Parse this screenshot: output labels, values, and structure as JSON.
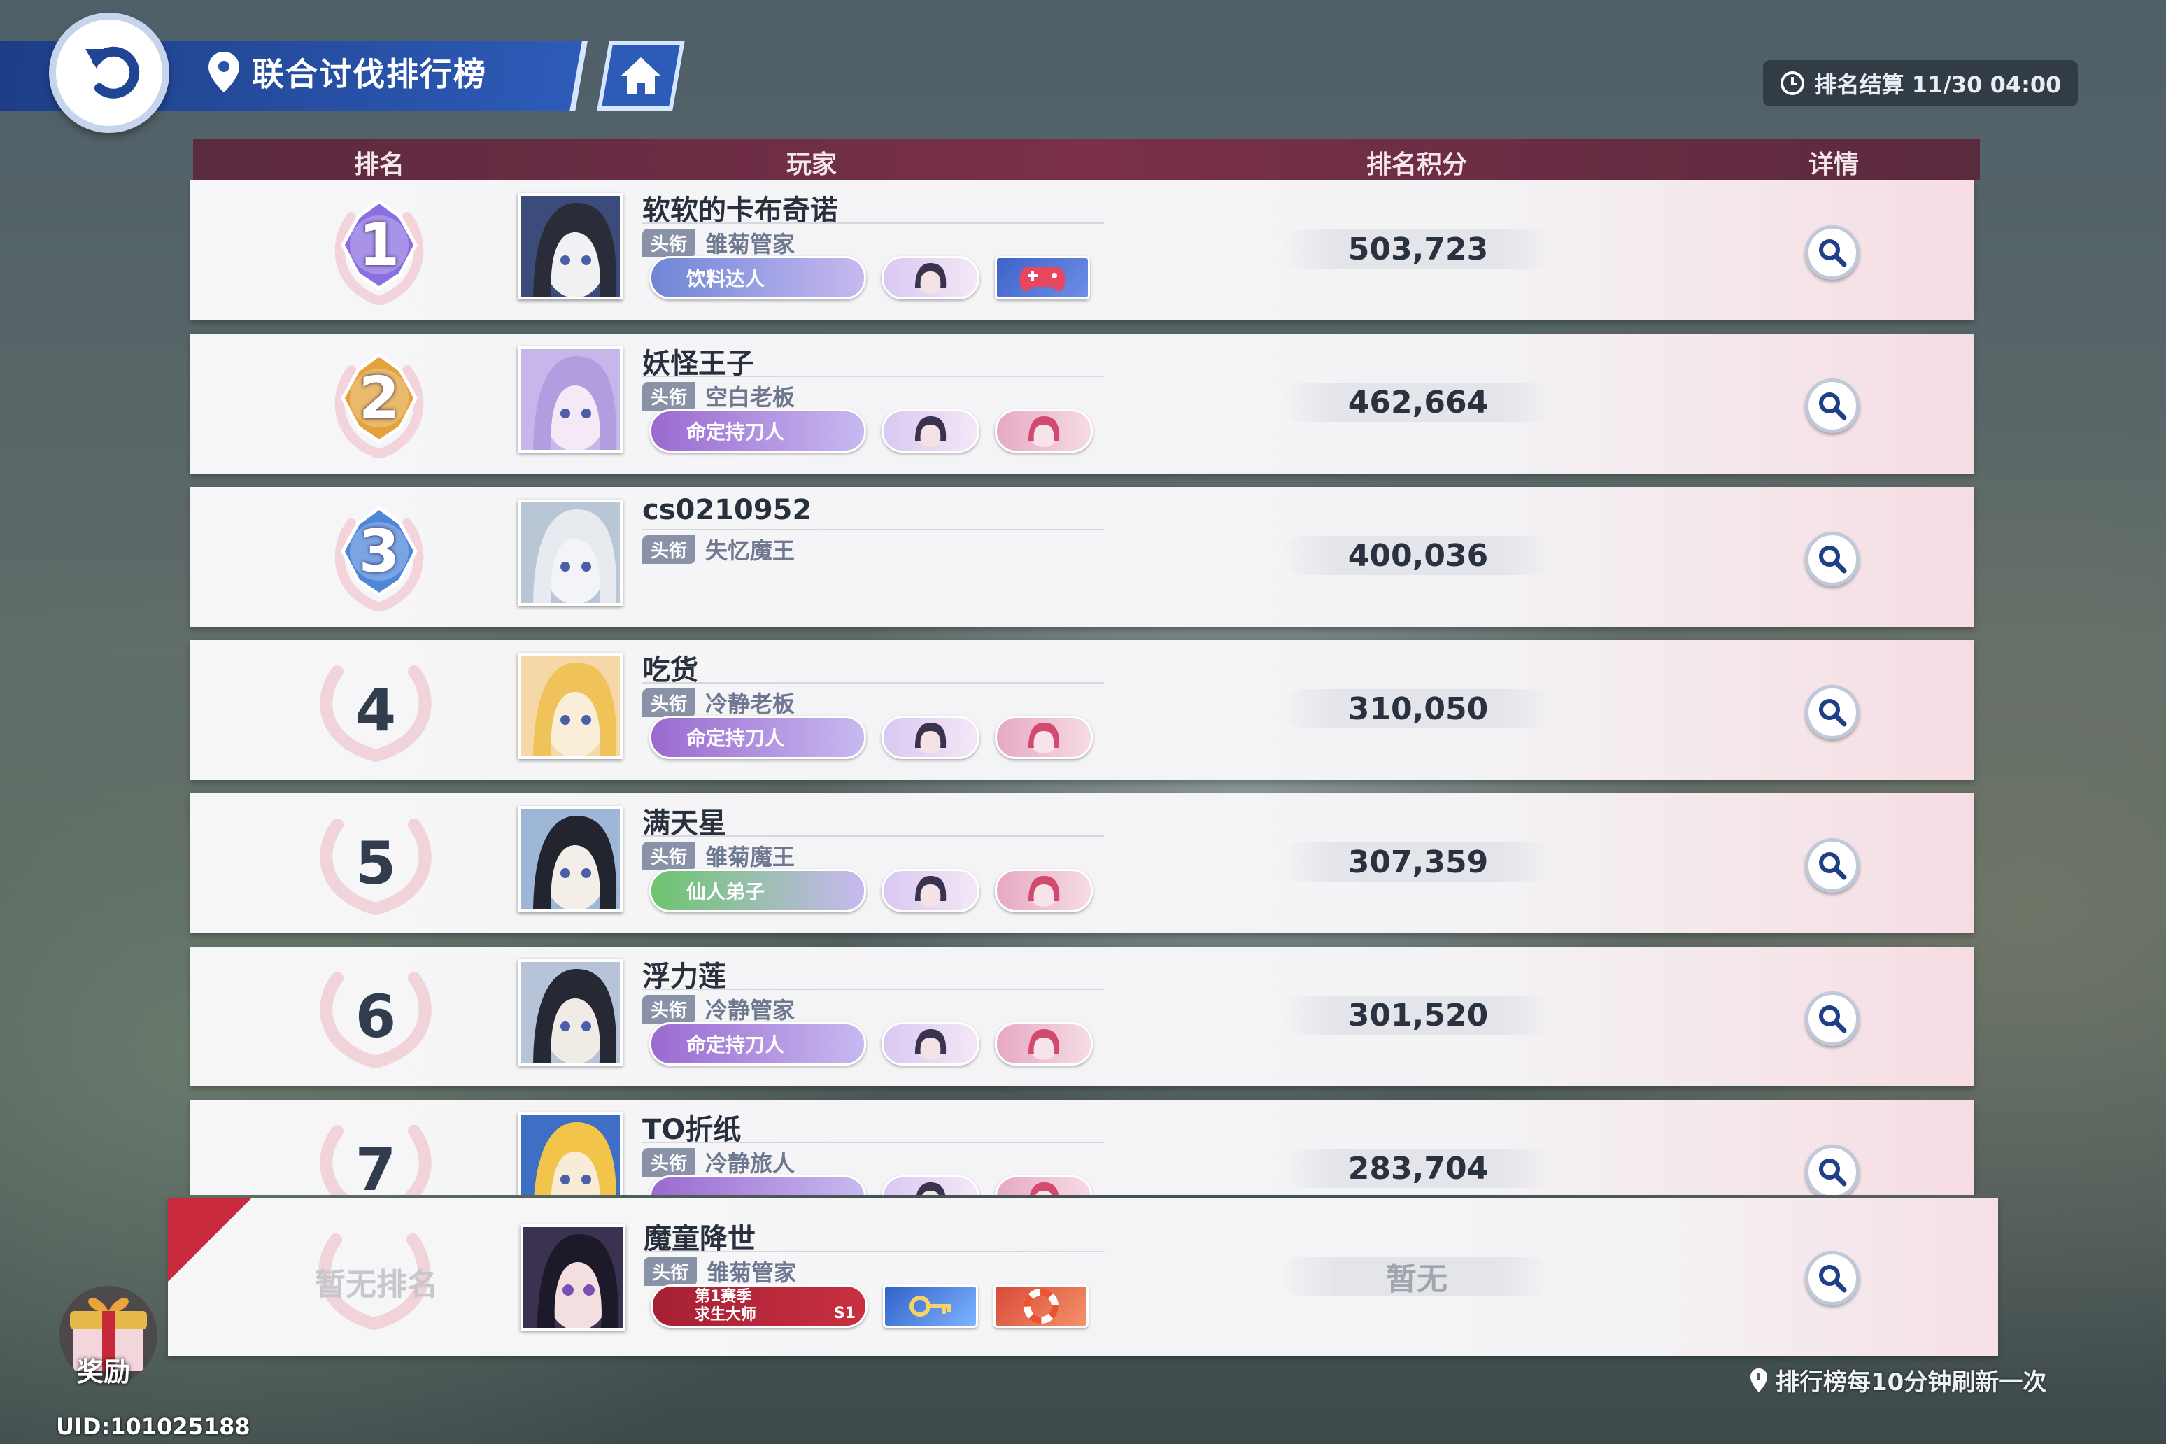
{
  "header": {
    "location": "联合讨伐排行榜",
    "settle_label": "排名结算 11/30 04:00",
    "columns": {
      "rank": "排名",
      "player": "玩家",
      "score": "排名积分",
      "detail": "详情"
    }
  },
  "title_tag": "头衔",
  "rows": [
    {
      "rank": "1",
      "name": "软软的卡布奇诺",
      "title": "雏菊管家",
      "score": "503,723",
      "badge_pill": "饮料达人",
      "pill_color": "#6f86d6",
      "medal_color": "#8b6fe0"
    },
    {
      "rank": "2",
      "name": "妖怪王子",
      "title": "空白老板",
      "score": "462,664",
      "badge_pill": "命定持刀人",
      "pill_color": "#9a6ad0",
      "medal_color": "#e5a23a"
    },
    {
      "rank": "3",
      "name": "cs0210952",
      "title": "失忆魔王",
      "score": "400,036",
      "badge_pill": "",
      "pill_color": "",
      "medal_color": "#4f86d8"
    },
    {
      "rank": "4",
      "name": "吃货",
      "title": "冷静老板",
      "score": "310,050",
      "badge_pill": "命定持刀人",
      "pill_color": "#9a6ad0"
    },
    {
      "rank": "5",
      "name": "满天星",
      "title": "雏菊魔王",
      "score": "307,359",
      "badge_pill": "仙人弟子",
      "pill_color": "#6cc46e"
    },
    {
      "rank": "6",
      "name": "浮力莲",
      "title": "冷静管家",
      "score": "301,520",
      "badge_pill": "命定持刀人",
      "pill_color": "#9a6ad0"
    },
    {
      "rank": "7",
      "name": "TO折纸",
      "title": "冷静旅人",
      "score": "283,704",
      "badge_pill": "",
      "pill_color": "#9a6ad0"
    }
  ],
  "me": {
    "rank_text": "暂无排名",
    "name": "魔童降世",
    "title": "雏菊管家",
    "score": "暂无",
    "badge_line1": "第1赛季",
    "badge_line2": "求生大师",
    "season_tag": "S1"
  },
  "footer": {
    "reward_label": "奖励",
    "refresh_note": "排行榜每10分钟刷新一次",
    "uid": "UID:101025188"
  }
}
